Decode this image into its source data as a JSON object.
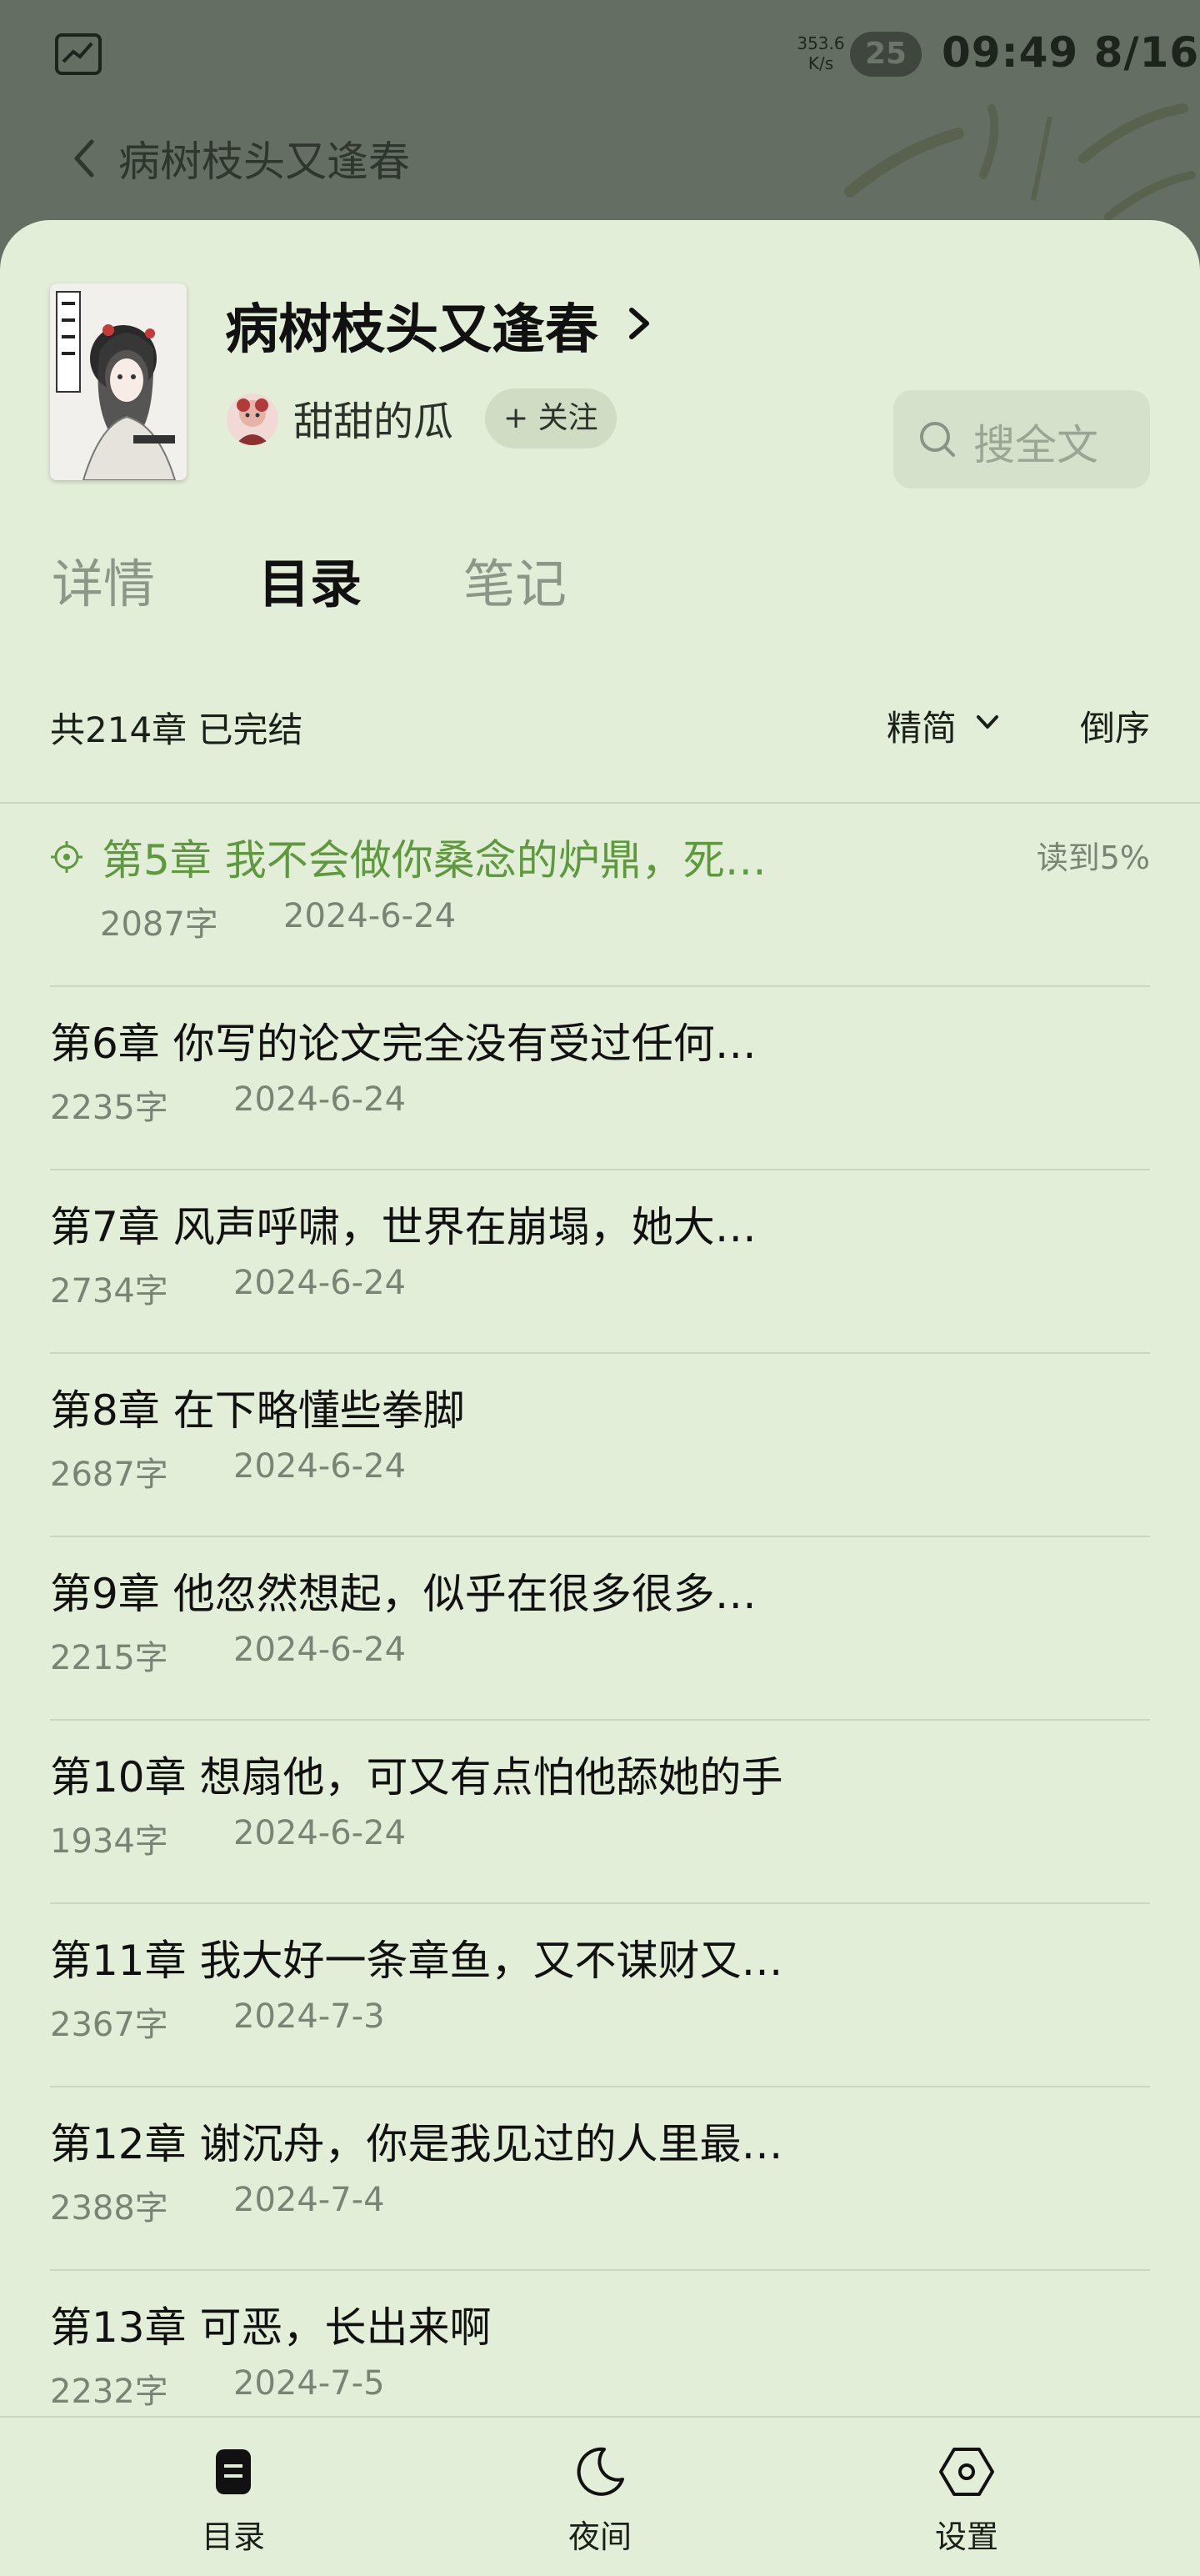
{
  "status_bar": {
    "net_speed": "353.6",
    "net_unit": "K/s",
    "battery": "25",
    "time": "09:49 8/16"
  },
  "top_nav": {
    "title": "病树枝头又逢春"
  },
  "book": {
    "title": "病树枝头又逢春",
    "author": "甜甜的瓜",
    "follow_label": "+ 关注",
    "search_label": "搜全文"
  },
  "tabs": [
    {
      "label": "详情",
      "active": false
    },
    {
      "label": "目录",
      "active": true
    },
    {
      "label": "笔记",
      "active": false
    }
  ],
  "catalog": {
    "summary": "共214章 已完结",
    "sort_mode": "精简",
    "order_label": "倒序",
    "chapters": [
      {
        "title": "第5章 我不会做你桑念的炉鼎，死…",
        "words": "2087字",
        "date": "2024-6-24",
        "current": true,
        "progress": "读到5%"
      },
      {
        "title": "第6章 你写的论文完全没有受过任何…",
        "words": "2235字",
        "date": "2024-6-24"
      },
      {
        "title": "第7章 风声呼啸，世界在崩塌，她大…",
        "words": "2734字",
        "date": "2024-6-24"
      },
      {
        "title": "第8章 在下略懂些拳脚",
        "words": "2687字",
        "date": "2024-6-24"
      },
      {
        "title": "第9章 他忽然想起，似乎在很多很多…",
        "words": "2215字",
        "date": "2024-6-24"
      },
      {
        "title": "第10章 想扇他，可又有点怕他舔她的手",
        "words": "1934字",
        "date": "2024-6-24"
      },
      {
        "title": "第11章 我大好一条章鱼，又不谋财又…",
        "words": "2367字",
        "date": "2024-7-3"
      },
      {
        "title": "第12章 谢沉舟，你是我见过的人里最…",
        "words": "2388字",
        "date": "2024-7-4"
      },
      {
        "title": "第13章 可恶，长出来啊",
        "words": "2232字",
        "date": "2024-7-5"
      }
    ]
  },
  "bottom_bar": [
    {
      "label": "目录",
      "icon": "catalog-icon"
    },
    {
      "label": "夜间",
      "icon": "moon-icon"
    },
    {
      "label": "设置",
      "icon": "settings-hexagon-icon"
    }
  ],
  "colors": {
    "sheet_background": "#e3eed8",
    "current_chapter": "#5e9a3d",
    "dim_overlay": "#646e63"
  }
}
